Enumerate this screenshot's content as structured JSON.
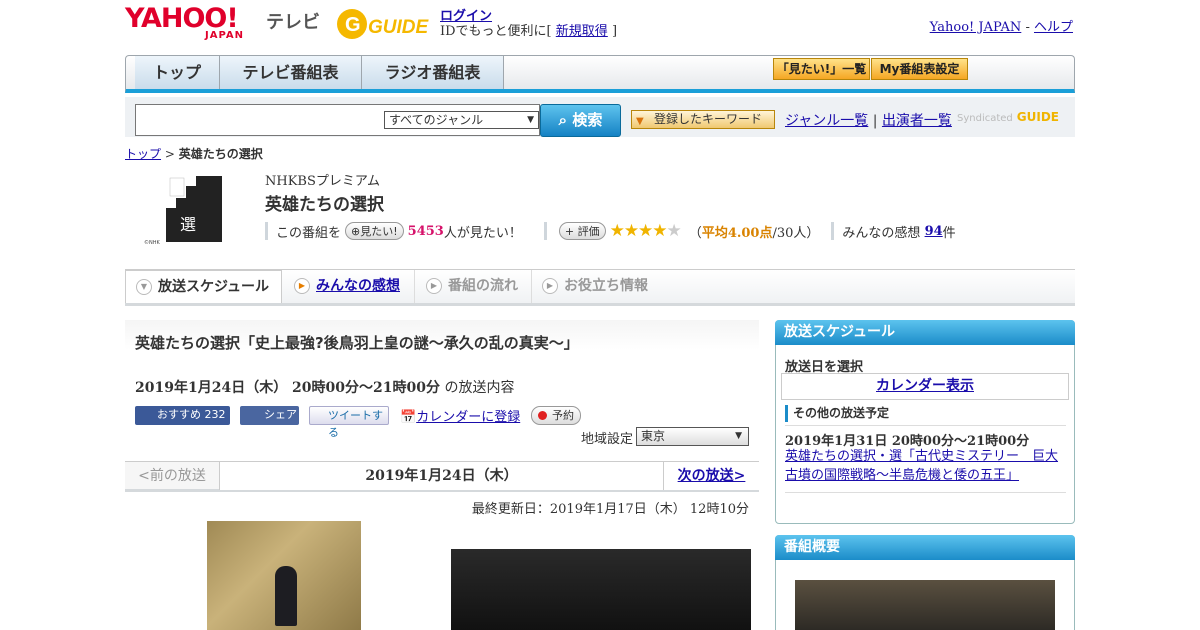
{
  "header": {
    "logo_text": "YAHOO!",
    "logo_sub": "JAPAN",
    "tv_label": "テレビ",
    "gguide_label": "GUIDE",
    "login": "ログイン",
    "id_text_pre": "IDでもっと便利に[",
    "signup": "新規取得",
    "id_text_post": "]",
    "yahoo_japan": "Yahoo! JAPAN",
    "sep": "-",
    "help": "ヘルプ"
  },
  "nav": {
    "tabs": [
      "トップ",
      "テレビ番組表",
      "ラジオ番組表"
    ],
    "mitai_list": "「見たい!」一覧",
    "my_schedule": "My番組表設定"
  },
  "search": {
    "genre_select": "すべてのジャンル",
    "button": "検索",
    "keyword_button": "登録したキーワード",
    "genre_list": "ジャンル一覧",
    "divider": "|",
    "performer_list": "出演者一覧",
    "syndicated": "Syndicated"
  },
  "breadcrumb": {
    "top": "トップ",
    "sep": ">",
    "current": "英雄たちの選択"
  },
  "program": {
    "channel": "NHKBSプレミアム",
    "title": "英雄たちの選択",
    "kono": "この番組を",
    "mitai_btn": "見たい!",
    "mitai_count": "5453",
    "mitai_suffix": "人が見たい！",
    "eval_btn": "評価",
    "stars_on": "★★★★",
    "stars_off": "★",
    "rating_pre": "（",
    "rating_avg": "平均4.00点",
    "rating_post": "/30人）",
    "kansou_label": "みんなの感想",
    "kansou_count": "94",
    "kansou_suffix": "件"
  },
  "tabs": {
    "schedule": "放送スケジュール",
    "kansou": "みんなの感想",
    "flow": "番組の流れ",
    "info": "お役立ち情報"
  },
  "episode": {
    "title": "英雄たちの選択「史上最強?後鳥羽上皇の謎～承久の乱の真実～」",
    "date": "2019年1月24日（木）  20時00分～21時00分",
    "date_suffix": "の放送内容",
    "fb_recommend": "おすすめ 232",
    "fb_share": "シェア",
    "tweet": "ツイートする",
    "calendar": "カレンダーに登録",
    "reserve": "予約",
    "region_label": "地域設定",
    "region_value": "東京",
    "prev": "<前の放送",
    "current": "2019年1月24日（木）",
    "next": "次の放送>",
    "updated": "最終更新日：2019年1月17日（木）  12時10分"
  },
  "sidebar": {
    "schedule_head": "放送スケジュール",
    "select_date": "放送日を選択",
    "calendar_view": "カレンダー表示",
    "other_head": "その他の放送予定",
    "other_date": "2019年1月31日  20時00分～21時00分",
    "other_link": "英雄たちの選択・選「古代史ミステリー　巨大古墳の国際戦略～半島危機と倭の五王」",
    "summary_head": "番組概要"
  },
  "colors": {
    "accent_blue": "#1b8cc9",
    "yahoo_red": "#e0002b",
    "pink": "#d6126a",
    "orange": "#d98300"
  }
}
